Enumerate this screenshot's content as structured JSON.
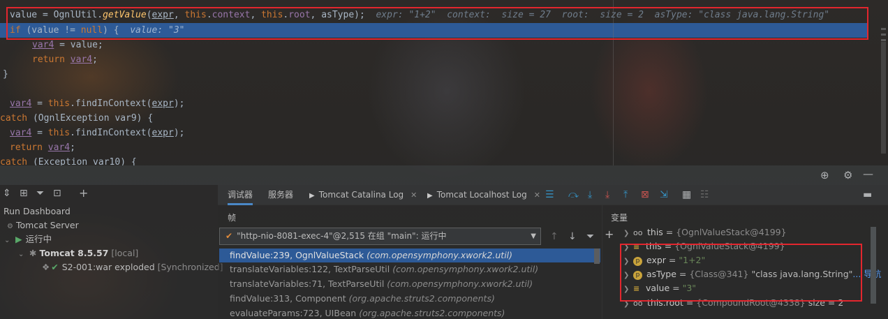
{
  "editor": {
    "lines": {
      "l1": {
        "value_var": "value",
        "eq": " = ",
        "cls": "OgnlUtil.",
        "method": "getValue",
        "open": "(",
        "arg1": "expr",
        "sep1": ", ",
        "this1": "this",
        "dot1": ".",
        "ctx": "context",
        "sep2": ", ",
        "this2": "this",
        "dot2": ".",
        "root": "root",
        "rest": ", asType);",
        "hint": "  expr: \"1+2\"  context:  size = 27  root:  size = 2  asType: \"class java.lang.String\""
      },
      "l2": {
        "kw": "if",
        "text": " (value != ",
        "null_kw": "null",
        "close": ") {",
        "hint": "  value: \"3\""
      },
      "l3": {
        "var": "var4",
        "text": " = value;"
      },
      "l4": {
        "kw": "return",
        "sp": " ",
        "var": "var4",
        "semi": ";"
      },
      "l5": {
        "text": "}"
      },
      "l6": {
        "var": "var4",
        "eq": " = ",
        "this": "this",
        "text": ".findInContext(",
        "arg": "expr",
        "close": ");"
      },
      "l7": {
        "kw": "catch",
        "text": " (OgnlException var9) {"
      },
      "l8": {
        "var": "var4",
        "eq": " = ",
        "this": "this",
        "text": ".findInContext(",
        "arg": "expr",
        "close": ");"
      },
      "l9": {
        "kw": "return",
        "sp": " ",
        "var": "var4",
        "semi": ";"
      },
      "l10": {
        "kw": "catch",
        "text": " (Exception var10) {"
      }
    }
  },
  "run": {
    "title": "Run Dashboard",
    "tomcat_server": "Tomcat Server",
    "running": "运行中",
    "tomcat_name": "Tomcat 8.5.57",
    "tomcat_local": "[local]",
    "artifact": "S2-001:war exploded",
    "artifact_status": "[Synchronized]"
  },
  "tabs": {
    "debugger": "调试器",
    "server": "服务器",
    "catalina": "Tomcat Catalina Log",
    "localhost": "Tomcat Localhost Log"
  },
  "frames": {
    "title": "帧",
    "thread": "\"http-nio-8081-exec-4\"@2,515 在组 \"main\": 运行中",
    "rows": [
      {
        "method": "findValue:239, OgnlValueStack ",
        "pkg": "(com.opensymphony.xwork2.util)"
      },
      {
        "method": "translateVariables:122, TextParseUtil ",
        "pkg": "(com.opensymphony.xwork2.util)"
      },
      {
        "method": "translateVariables:71, TextParseUtil ",
        "pkg": "(com.opensymphony.xwork2.util)"
      },
      {
        "method": "findValue:313, Component ",
        "pkg": "(org.apache.struts2.components)"
      },
      {
        "method": "evaluateParams:723, UIBean ",
        "pkg": "(org.apache.struts2.components)"
      }
    ]
  },
  "variables": {
    "title": "变量",
    "rows": [
      {
        "name": "this",
        "eq": " = ",
        "val": "{OgnlValueStack@4199}",
        "extra": "",
        "link": ""
      },
      {
        "name": "this",
        "eq": " = ",
        "val": "{OgnlValueStack@4199}",
        "extra": "",
        "link": ""
      },
      {
        "name": "expr",
        "eq": " = ",
        "val": "\"1+2\"",
        "extra": "",
        "link": ""
      },
      {
        "name": "asType",
        "eq": " = ",
        "val": "{Class@341}",
        "extra": " \"class java.lang.String\"",
        "link": "... 导航"
      },
      {
        "name": "value",
        "eq": " = ",
        "val": "\"3\"",
        "extra": "",
        "link": ""
      },
      {
        "name": "this.root",
        "eq": " = ",
        "val": "{CompoundRoot@4338}",
        "extra": "  size = 2",
        "link": ""
      }
    ]
  },
  "colors": {
    "highlight": "#2d5a97",
    "annotation_red": "#e3262e",
    "keyword": "#cc7832",
    "string": "#6a8759"
  }
}
